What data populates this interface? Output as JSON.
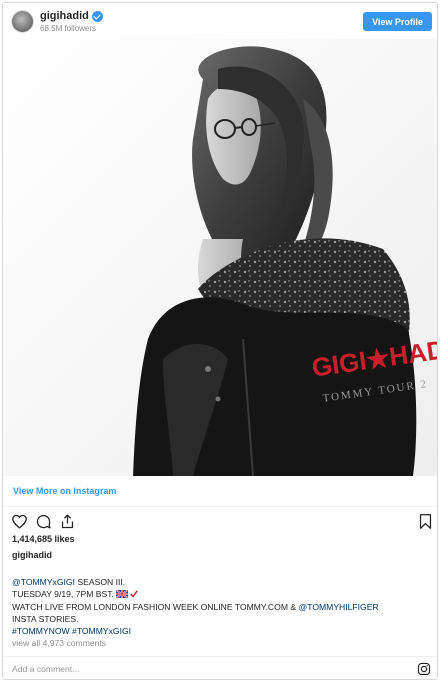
{
  "header": {
    "username": "gigihadid",
    "followers": "68.5M followers",
    "view_profile_label": "View Profile"
  },
  "photo": {
    "jacket_text": "GIGI★HADID",
    "jacket_subtext": "TOMMY TOUR 2"
  },
  "view_more_label": "View More on Instagram",
  "actions": {
    "icons": [
      "heart-icon",
      "comment-icon",
      "share-icon",
      "bookmark-icon"
    ]
  },
  "likes": "1,414,685 likes",
  "caption": {
    "username": "gigihadid",
    "line1_mention": "@TOMMYxGIGI",
    "line1_text": " SEASON III.",
    "line2_text": "TUESDAY 9/19, 7PM BST.",
    "line3_text": "WATCH LIVE FROM LONDON FASHION WEEK ONLINE TOMMY.COM & ",
    "line3_mention": "@TOMMYHILFIGER",
    "line4_text": "INSTA STORIES.",
    "hashtag1": "#TOMMYNOW",
    "hashtag2": "#TOMMYxGIGI"
  },
  "view_all_comments": "view all 4,973 comments",
  "comment": {
    "placeholder": "Add a comment..."
  },
  "colors": {
    "accent": "#3897f0",
    "link": "#003569",
    "muted": "#8e8e8e",
    "jacket_red": "#c8202b"
  }
}
